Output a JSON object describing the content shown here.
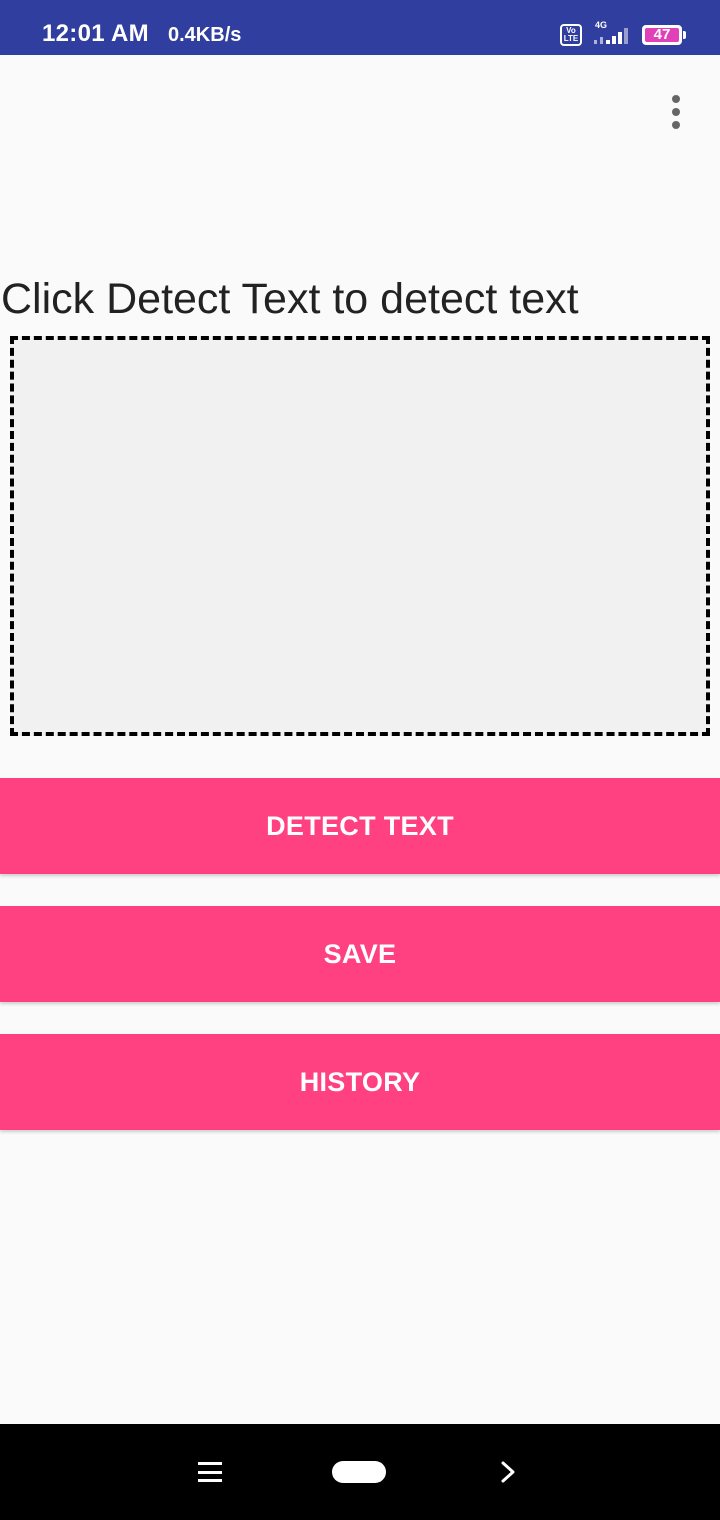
{
  "status_bar": {
    "time": "12:01 AM",
    "network_speed": "0.4KB/s",
    "volte_label_top": "Vo",
    "volte_label_bottom": "LTE",
    "network_type": "4G",
    "battery_level": "47",
    "bar_color": "#303f9f"
  },
  "app": {
    "overflow_menu_icon": "more-vert-icon",
    "prompt": "Click Detect Text to detect text",
    "preview_placeholder_color": "#f1f1f1",
    "buttons": {
      "detect_text": "DETECT TEXT",
      "save": "SAVE",
      "history": "HISTORY"
    },
    "accent_color": "#ff4081"
  },
  "nav_bar": {
    "menu_icon": "menu-icon",
    "home_icon": "home-pill-icon",
    "back_icon": "chevron-right-icon"
  }
}
